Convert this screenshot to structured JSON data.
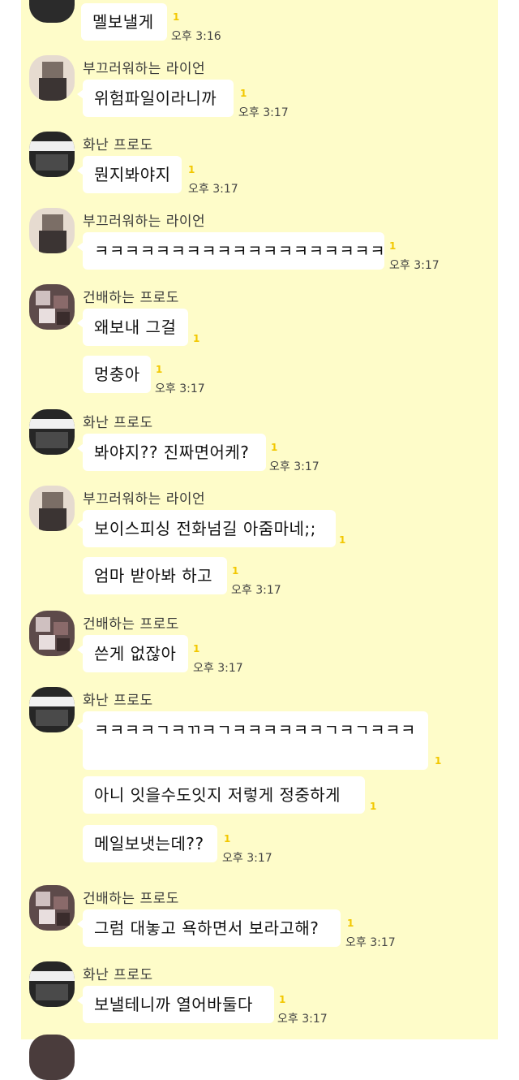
{
  "messages": [
    {
      "text": "멜보낼게",
      "unread": "1",
      "time": "오후 3:16"
    },
    {
      "sender": "부끄러워하는 라이언",
      "text": "위험파일이라니까",
      "unread": "1",
      "time": "오후 3:17"
    },
    {
      "sender": "화난 프로도",
      "text": "뭔지봐야지",
      "unread": "1",
      "time": "오후 3:17"
    },
    {
      "sender": "부끄러워하는 라이언",
      "text": "ㅋㅋㅋㅋㅋㅋㅋㅋㅋㅋㅋㅋㅋㅋㅋㅋㅋㅋㅋ",
      "unread": "1",
      "time": "오후 3:17"
    },
    {
      "sender": "건배하는 프로도",
      "text": "왜보내 그걸",
      "unread": "1"
    },
    {
      "text": "멍충아",
      "unread": "1",
      "time": "오후 3:17"
    },
    {
      "sender": "화난 프로도",
      "text": "봐야지?? 진짜면어케?",
      "unread": "1",
      "time": "오후 3:17"
    },
    {
      "sender": "부끄러워하는 라이언",
      "text": "보이스피싱 전화넘길 아줌마네;;",
      "unread": "1"
    },
    {
      "text": "엄마 받아봐 하고",
      "unread": "1",
      "time": "오후 3:17"
    },
    {
      "sender": "건배하는 프로도",
      "text": "쓴게 없잖아",
      "unread": "1",
      "time": "오후 3:17"
    },
    {
      "sender": "화난 프로도",
      "text": "ㅋㅋㅋㅋㄱㅋㄲㅋㄱㅋㅋㅋㅋㅋㅋㄱㅋㄱㅋㅋㅋ",
      "unread": "1"
    },
    {
      "text": "아니 잇을수도잇지 저렇게 정중하게",
      "unread": "1"
    },
    {
      "text": "메일보냇는데??",
      "unread": "1",
      "time": "오후 3:17"
    },
    {
      "sender": "건배하는 프로도",
      "text": "그럼 대놓고 욕하면서 보라고해?",
      "unread": "1",
      "time": "오후 3:17"
    },
    {
      "sender": "화난 프로도",
      "text": "보낼테니까 열어바둘다",
      "unread": "1",
      "time": "오후 3:17"
    }
  ],
  "colors": {
    "chat_bg": "#fefcc9",
    "bubble": "#ffffff",
    "unread": "#f2c700"
  }
}
